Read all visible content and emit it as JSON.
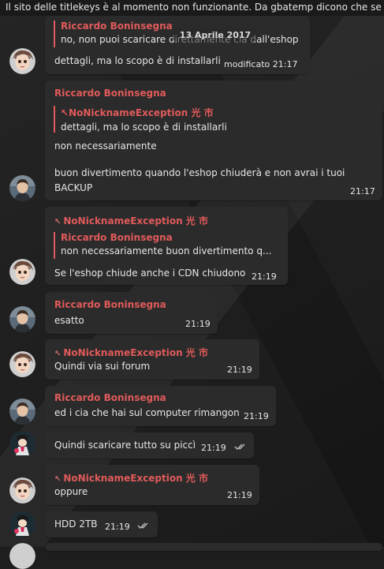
{
  "pinned_bar": {
    "text": "Il sito delle titlekeys è al momento non funzionante. Da gbatemp dicono che se"
  },
  "date_separator": "13 Aprile 2017",
  "messages": [
    {
      "reply_name": "Riccardo Boninsegna",
      "reply_text": "no, non puoi scaricare direttamente cia dall'eshop",
      "text": "dettagli, ma lo scopo è di installarli",
      "time": "modificato 21:17"
    },
    {
      "author": "Riccardo Boninsegna",
      "reply_name": "NoNicknameException 光 市",
      "reply_text": "dettagli, ma lo scopo è di installarli",
      "text_lines": [
        "non necessariamente",
        "",
        "buon divertimento quando l'eshop chiuderà e non avrai i tuoi",
        "BACKUP"
      ],
      "time": "21:17"
    },
    {
      "author": "NoNicknameException 光 市",
      "reply_name": "Riccardo Boninsegna",
      "reply_text": "non necessariamente  buon divertimento q...",
      "text": "Se l'eshop chiude anche i CDN chiudono",
      "time": "21:19"
    },
    {
      "author": "Riccardo Boninsegna",
      "text": "esatto",
      "time": "21:19"
    },
    {
      "author": "NoNicknameException 光 市",
      "text": "Quindi via sui forum",
      "time": "21:19"
    },
    {
      "author": "Riccardo Boninsegna",
      "text": "ed i cia che hai sul computer rimangon",
      "time": "21:19"
    },
    {
      "text": "Quindi scaricare tutto su piccì",
      "time": "21:19"
    },
    {
      "author": "NoNicknameException 光 市",
      "text": "oppure",
      "time": "21:19"
    },
    {
      "text": "HDD 2TB",
      "time": "21:19"
    }
  ],
  "icons": {
    "read_status": "double-check-icon",
    "forward_mark": "wrench-icon"
  },
  "colors": {
    "author_name": "#e05a5a",
    "bubble_bg": "#2b2b2b",
    "chat_bg": "#1e1e1e"
  }
}
